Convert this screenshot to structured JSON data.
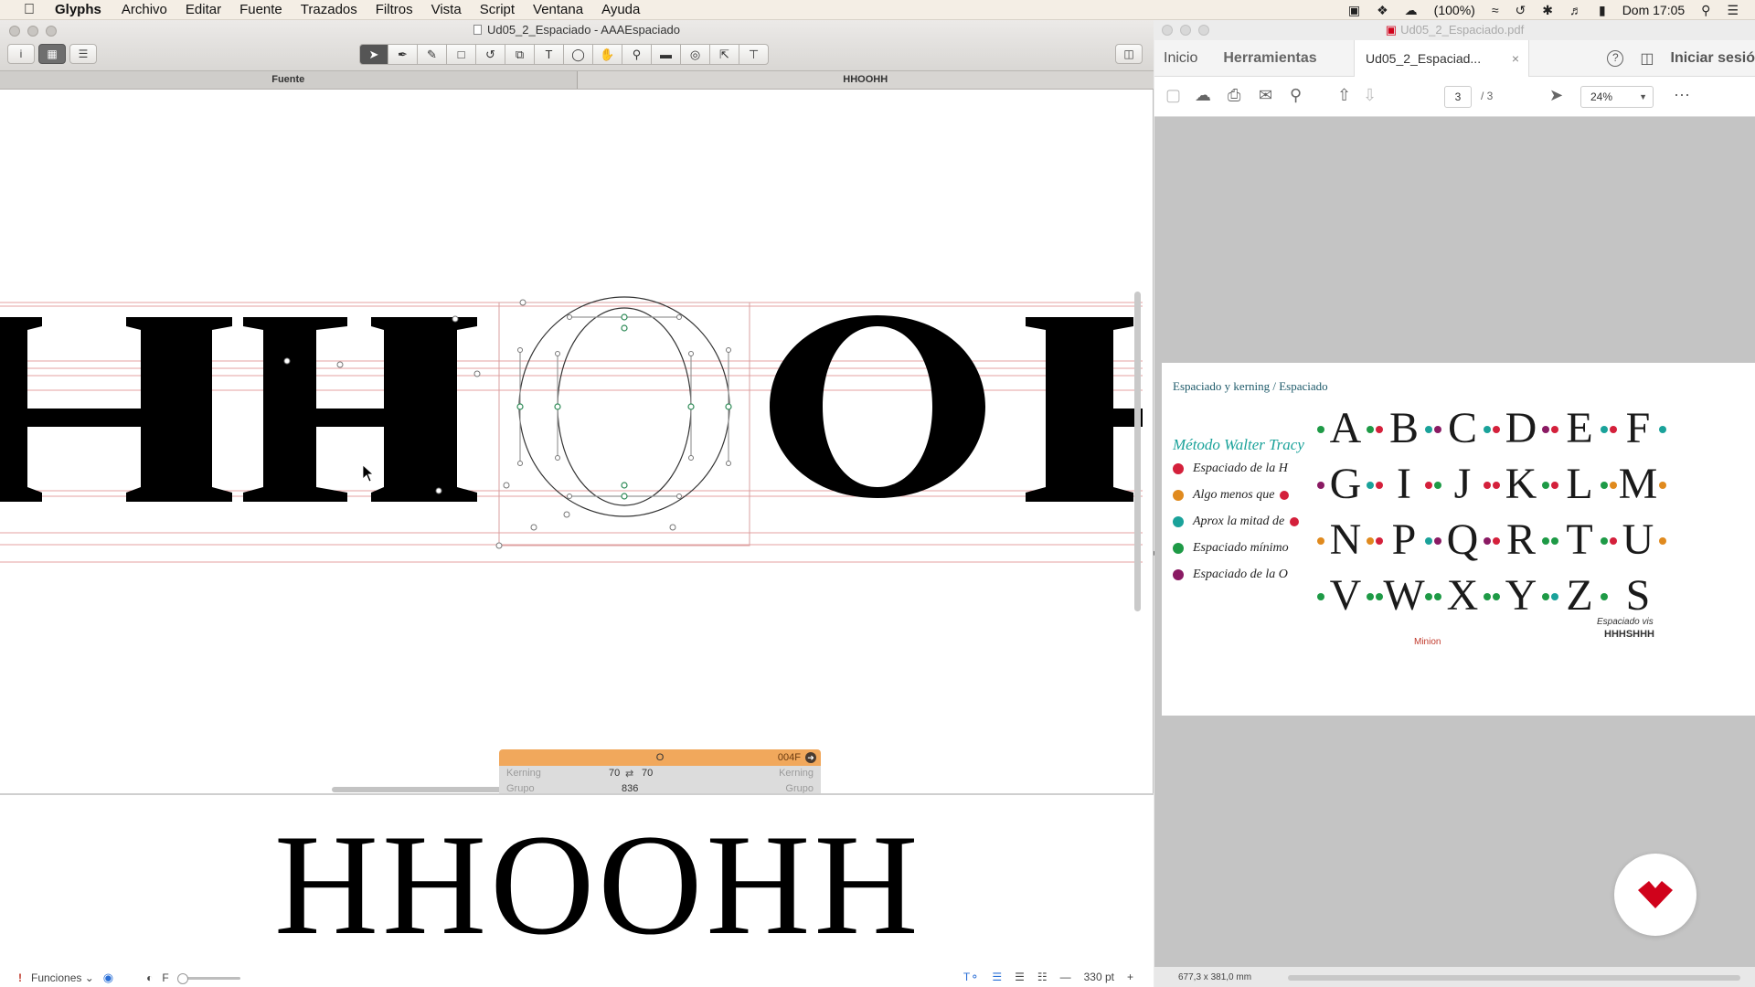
{
  "menubar": {
    "app_name": "Glyphs",
    "items": [
      "Archivo",
      "Editar",
      "Fuente",
      "Trazados",
      "Filtros",
      "Vista",
      "Script",
      "Ventana",
      "Ayuda"
    ],
    "battery": "(100%)",
    "clock": "Dom 17:05"
  },
  "glyphs_window": {
    "title": "Ud05_2_Espaciado - AAAEspaciado",
    "tabs": [
      "Fuente",
      "HHOOHH"
    ],
    "info_box": {
      "glyph_name": "O",
      "unicode": "004F",
      "kerning_label": "Kerning",
      "group_label": "Grupo",
      "lsb": "70",
      "rsb": "70",
      "width": "836"
    },
    "preview_text": "HHOOHH",
    "status": {
      "funciones": "Funciones",
      "f_label": "F",
      "size": "330 pt"
    }
  },
  "pdf_window": {
    "title": "Ud05_2_Espaciado.pdf",
    "nav": {
      "inicio": "Inicio",
      "herramientas": "Herramientas",
      "doc_tab": "Ud05_2_Espaciad...",
      "help": "?",
      "login": "Iniciar sesió"
    },
    "toolbar": {
      "page": "3",
      "page_total": "/ 3",
      "zoom": "24%"
    },
    "page": {
      "header": "Espaciado y kerning / Espaciado",
      "method_title": "Método Walter Tracy",
      "legend": [
        {
          "label": "Espaciado de la H",
          "color": "#d4203b",
          "tail": ""
        },
        {
          "label": "Algo menos que",
          "color": "#e08a1e",
          "tail": "#d4203b"
        },
        {
          "label": "Aprox la mitad de",
          "color": "#1aa29a",
          "tail": "#d4203b"
        },
        {
          "label": "Espaciado mínimo",
          "color": "#1e9a46",
          "tail": ""
        },
        {
          "label": "Espaciado de la O",
          "color": "#8a1a63",
          "tail": ""
        }
      ],
      "letters": [
        {
          "ch": "A",
          "l": "#1e9a46",
          "r": "#1e9a46"
        },
        {
          "ch": "B",
          "l": "#d4203b",
          "r": "#1aa29a"
        },
        {
          "ch": "C",
          "l": "#8a1a63",
          "r": "#1aa29a"
        },
        {
          "ch": "D",
          "l": "#d4203b",
          "r": "#8a1a63"
        },
        {
          "ch": "E",
          "l": "#d4203b",
          "r": "#1aa29a"
        },
        {
          "ch": "F",
          "l": "#d4203b",
          "r": "#1aa29a"
        },
        {
          "ch": "G",
          "l": "#8a1a63",
          "r": "#1aa29a"
        },
        {
          "ch": "I",
          "l": "#d4203b",
          "r": "#d4203b"
        },
        {
          "ch": "J",
          "l": "#1e9a46",
          "r": "#d4203b"
        },
        {
          "ch": "K",
          "l": "#d4203b",
          "r": "#1e9a46"
        },
        {
          "ch": "L",
          "l": "#d4203b",
          "r": "#1e9a46"
        },
        {
          "ch": "M",
          "l": "#e08a1e",
          "r": "#e08a1e"
        },
        {
          "ch": "N",
          "l": "#e08a1e",
          "r": "#e08a1e"
        },
        {
          "ch": "P",
          "l": "#d4203b",
          "r": "#1aa29a"
        },
        {
          "ch": "Q",
          "l": "#8a1a63",
          "r": "#8a1a63"
        },
        {
          "ch": "R",
          "l": "#d4203b",
          "r": "#1e9a46"
        },
        {
          "ch": "T",
          "l": "#1e9a46",
          "r": "#1e9a46"
        },
        {
          "ch": "U",
          "l": "#d4203b",
          "r": "#e08a1e"
        },
        {
          "ch": "V",
          "l": "#1e9a46",
          "r": "#1e9a46"
        },
        {
          "ch": "W",
          "l": "#1e9a46",
          "r": "#1e9a46"
        },
        {
          "ch": "X",
          "l": "#1e9a46",
          "r": "#1e9a46"
        },
        {
          "ch": "Y",
          "l": "#1e9a46",
          "r": "#1e9a46"
        },
        {
          "ch": "Z",
          "l": "#1aa29a",
          "r": "#1e9a46"
        },
        {
          "ch": "S",
          "l": "",
          "r": ""
        }
      ],
      "minion": "Minion",
      "espaciado_vis": "Espaciado vis",
      "hhhs": "HHHSHHH"
    },
    "status_dims": "677,3 x 381,0 mm"
  }
}
